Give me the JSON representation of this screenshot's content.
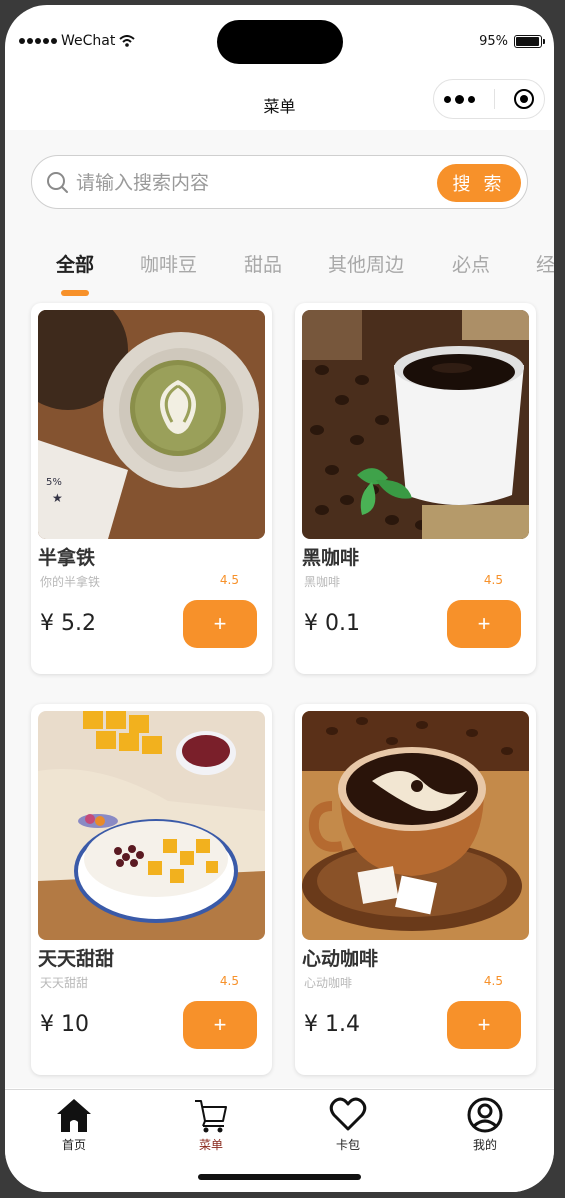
{
  "status_bar": {
    "carrier": "WeChat",
    "battery": "95%",
    "battery_level": 0.95
  },
  "nav": {
    "title": "菜单"
  },
  "search": {
    "placeholder": "请输入搜索内容",
    "button_label": "搜 索"
  },
  "categories": [
    "全部",
    "咖啡豆",
    "甜品",
    "其他周边",
    "必点",
    "经"
  ],
  "active_category": 0,
  "products": [
    {
      "name": "半拿铁",
      "subtitle": "你的半拿铁",
      "rating": "4.5",
      "price": "¥ 5.2",
      "add_label": "+",
      "image": "latte-art-photo"
    },
    {
      "name": "黑咖啡",
      "subtitle": "黑咖啡",
      "rating": "4.5",
      "price": "¥ 0.1",
      "add_label": "+",
      "image": "black-coffee-photo"
    },
    {
      "name": "天天甜甜",
      "subtitle": "天天甜甜",
      "rating": "4.5",
      "price": "¥ 10",
      "add_label": "+",
      "image": "mango-dessert-photo"
    },
    {
      "name": "心动咖啡",
      "subtitle": "心动咖啡",
      "rating": "4.5",
      "price": "¥ 1.4",
      "add_label": "+",
      "image": "coffee-sugar-photo"
    }
  ],
  "tabbar": [
    {
      "label": "首页",
      "icon": "home-icon"
    },
    {
      "label": "菜单",
      "icon": "cart-icon"
    },
    {
      "label": "卡包",
      "icon": "heart-icon"
    },
    {
      "label": "我的",
      "icon": "user-icon"
    }
  ],
  "colors": {
    "accent": "#f7912a",
    "active_tab_label": "#8a2a1e"
  }
}
